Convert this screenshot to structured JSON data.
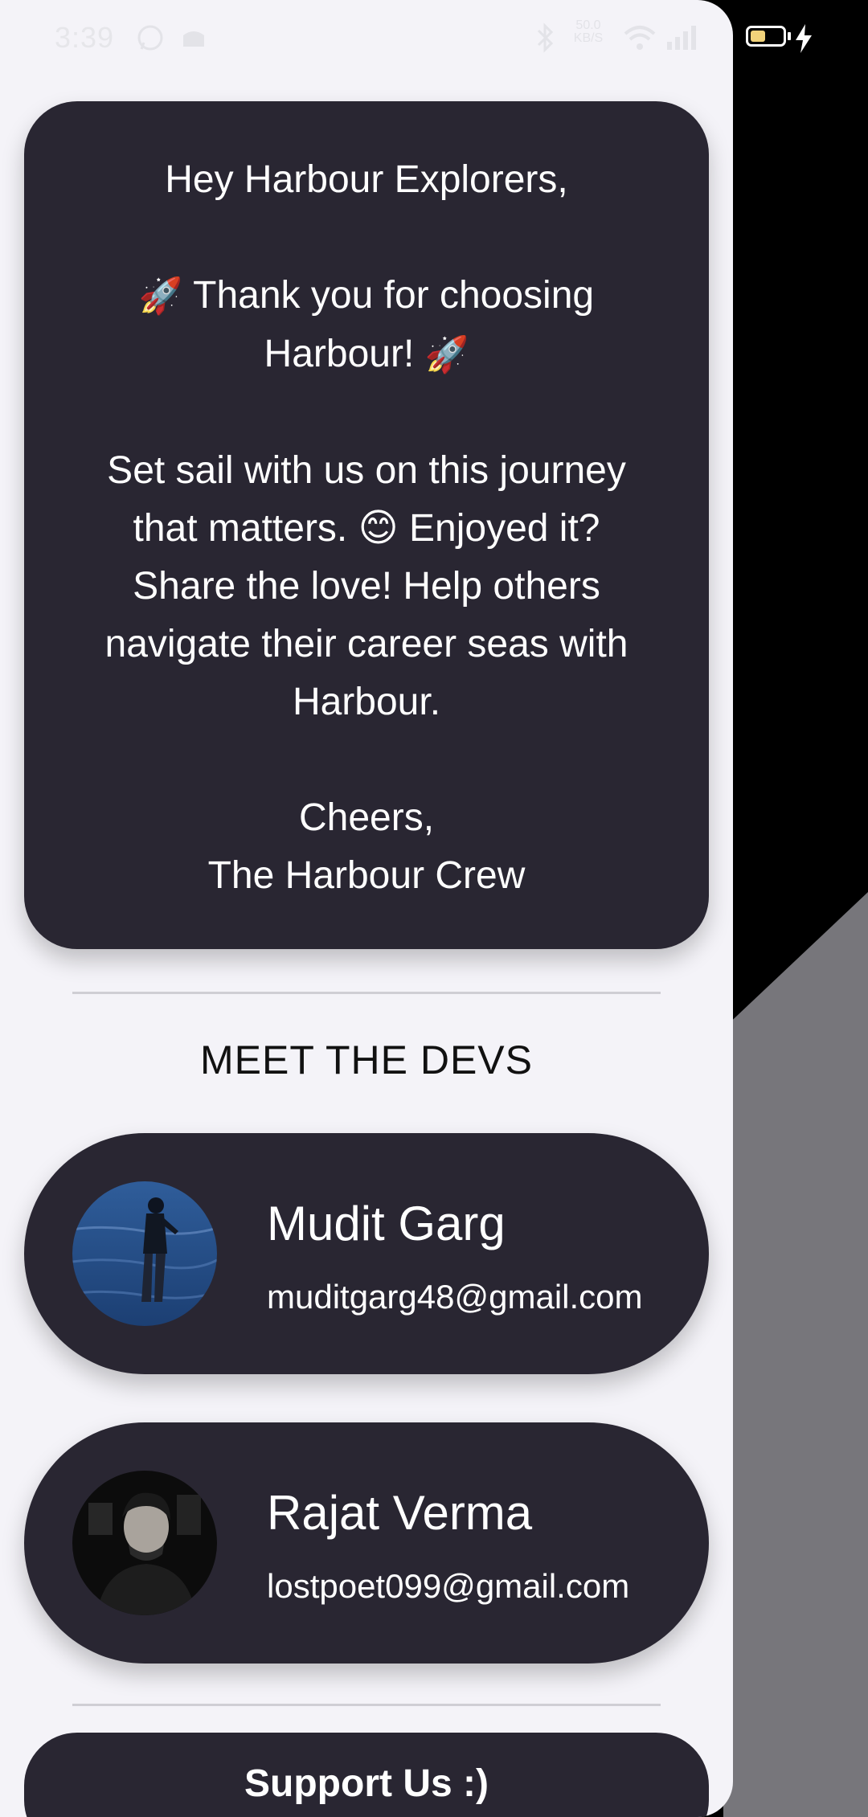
{
  "status_bar": {
    "time": "3:39",
    "net_speed": "50.0\nKB/S",
    "icons": [
      "whatsapp-icon",
      "notification-icon",
      "bluetooth-icon",
      "wifi-icon",
      "signal-icon",
      "battery-icon",
      "charging-icon"
    ]
  },
  "letter": {
    "greeting": "Hey Harbour Explorers,",
    "thanks_line1": "Thank you for choosing",
    "thanks_line2": "Harbour!",
    "body_line1": "Set sail with us on this journey",
    "body_line2a": "that matters.",
    "body_line2b": "Enjoyed it?",
    "body_line3": "Share the love! Help others",
    "body_line4": "navigate their career seas with",
    "body_line5": "Harbour.",
    "signoff1": "Cheers,",
    "signoff2": "The Harbour Crew"
  },
  "devs_section": {
    "title": "MEET THE DEVS",
    "devs": [
      {
        "name": "Mudit Garg",
        "email": "muditgarg48@gmail.com"
      },
      {
        "name": "Rajat Verma",
        "email": "lostpoet099@gmail.com"
      }
    ]
  },
  "support": {
    "label": "Support Us :)"
  },
  "colors": {
    "card": "#292632",
    "panel": "#f4f3f8",
    "battery": "#f1d27a",
    "side_grey": "#77767b"
  }
}
